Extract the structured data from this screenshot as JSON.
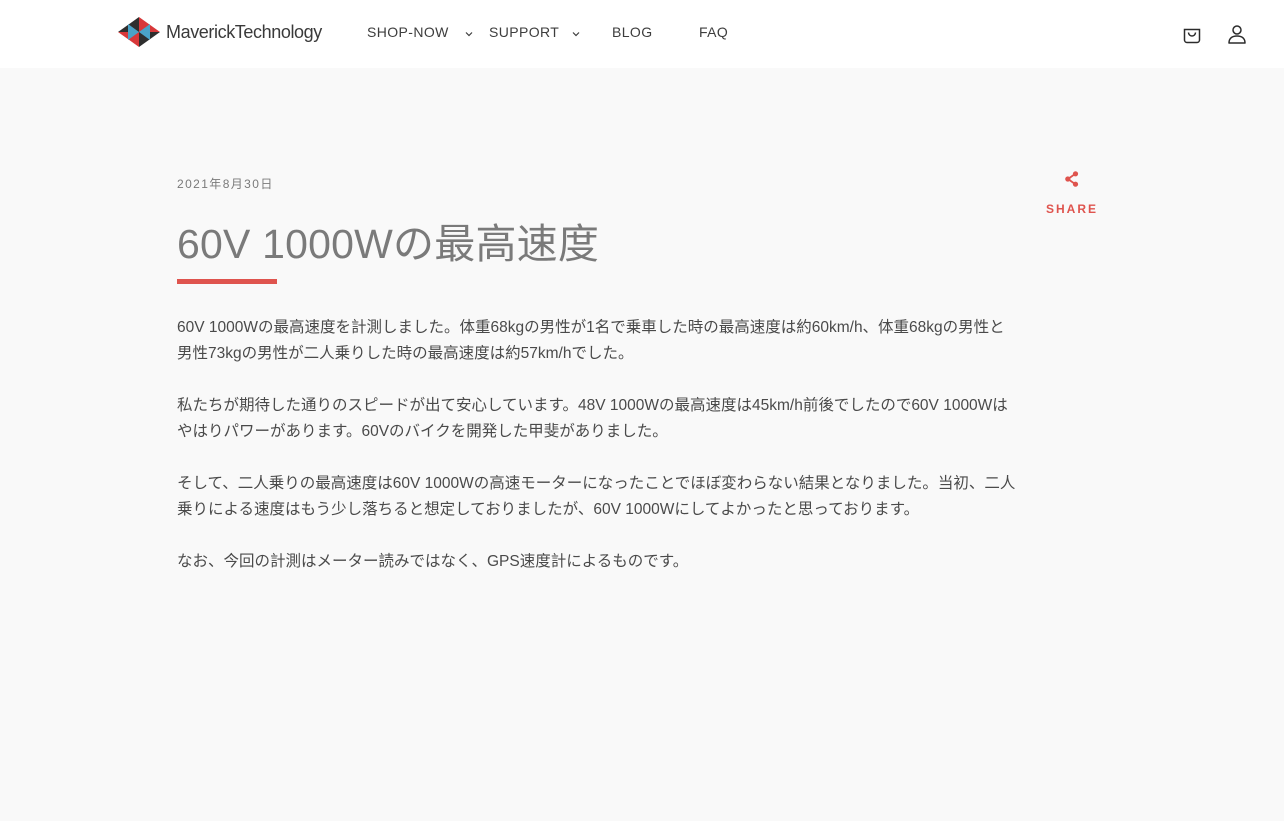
{
  "brand": {
    "name": "MaverickTechnology"
  },
  "nav": {
    "items": [
      {
        "label": "SHOP-NOW",
        "has_dropdown": true
      },
      {
        "label": "SUPPORT",
        "has_dropdown": true
      },
      {
        "label": "BLOG",
        "has_dropdown": false
      },
      {
        "label": "FAQ",
        "has_dropdown": false
      }
    ]
  },
  "header_icons": {
    "cart": "cart-icon",
    "account": "account-icon"
  },
  "article": {
    "date": "2021年8月30日",
    "title": "60V 1000Wの最高速度",
    "paragraphs": [
      "60V 1000Wの最高速度を計測しました。体重68kgの男性が1名で乗車した時の最高速度は約60km/h、体重68kgの男性と男性73kgの男性が二人乗りした時の最高速度は約57km/hでした。",
      "私たちが期待した通りのスピードが出て安心しています。48V 1000Wの最高速度は45km/h前後でしたので60V 1000Wはやはりパワーがあります。60Vのバイクを開発した甲斐がありました。",
      "そして、二人乗りの最高速度は60V 1000Wの高速モーターになったことでほぼ変わらない結果となりました。当初、二人乗りによる速度はもう少し落ちると想定しておりましたが、60V 1000Wにしてよかったと思っております。",
      "なお、今回の計測はメーター読みではなく、GPS速度計によるものです。"
    ]
  },
  "share": {
    "label": "SHARE",
    "icon": "share-icon"
  },
  "colors": {
    "accent": "#df544e",
    "background": "#f9f9f9",
    "header": "#ffffff"
  }
}
